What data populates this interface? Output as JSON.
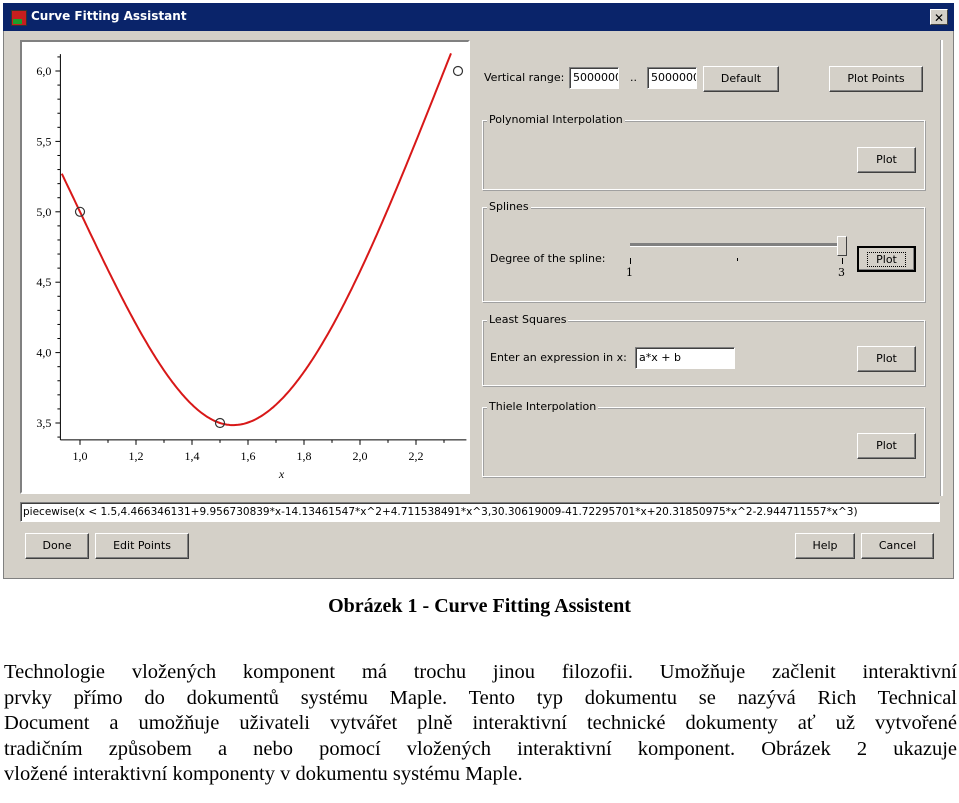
{
  "window": {
    "title": "Curve Fitting Assistant",
    "close_label": "✕"
  },
  "plot": {
    "chart_data": {
      "type": "line",
      "xlabel": "x",
      "ylabel": "",
      "x_ticks": [
        "1,0",
        "1,2",
        "1,4",
        "1,6",
        "1,8",
        "2,0",
        "2,2"
      ],
      "y_ticks": [
        "3,5",
        "4,0",
        "4,5",
        "5,0",
        "5,5",
        "6,0"
      ],
      "x_tick_values": [
        1.0,
        1.2,
        1.4,
        1.6,
        1.8,
        2.0,
        2.2
      ],
      "y_tick_values": [
        3.5,
        4.0,
        4.5,
        5.0,
        5.5,
        6.0
      ],
      "xlim": [
        0.92,
        2.38
      ],
      "ylim": [
        3.4,
        6.1
      ],
      "points": [
        {
          "x": 1.0,
          "y": 5.0
        },
        {
          "x": 1.5,
          "y": 3.5
        },
        {
          "x": 2.35,
          "y": 6.0
        }
      ],
      "series": [
        {
          "name": "spline",
          "color": "#d81818",
          "piecewise_break": 1.5,
          "left_coeffs": [
            4.466346131,
            9.956730839,
            -14.13461547,
            4.711538491
          ],
          "right_coeffs": [
            30.30619009,
            -41.72295701,
            20.31850975,
            -2.944711557
          ]
        }
      ],
      "grid": false
    }
  },
  "controls": {
    "vertical_range_label": "Vertical range:",
    "range_min": "5000000",
    "range_sep": "..",
    "range_max": "5000000",
    "default_button": "Default",
    "plot_points_button": "Plot Points",
    "polynomial": {
      "legend": "Polynomial Interpolation",
      "plot_button": "Plot"
    },
    "splines": {
      "legend": "Splines",
      "degree_label": "Degree of the spline:",
      "slider_min_label": "1",
      "slider_max_label": "3",
      "slider_value": 3,
      "plot_button": "Plot"
    },
    "least_squares": {
      "legend": "Least Squares",
      "expr_label": "Enter an expression in x:",
      "expr_value": "a*x + b",
      "plot_button": "Plot"
    },
    "thiele": {
      "legend": "Thiele Interpolation",
      "plot_button": "Plot"
    }
  },
  "result_text": "piecewise(x < 1.5,4.466346131+9.956730839*x-14.13461547*x^2+4.711538491*x^3,30.30619009-41.72295701*x+20.31850975*x^2-2.944711557*x^3)",
  "footer_buttons": {
    "done": "Done",
    "edit_points": "Edit Points",
    "help": "Help",
    "cancel": "Cancel"
  },
  "document": {
    "caption": "Obrázek 1 - Curve Fitting Assistent",
    "lines": [
      "Technologie vložených komponent má trochu jinou filozofii. Umožňuje začlenit interaktivní",
      "prvky přímo do dokumentů systému Maple. Tento typ dokumentu se nazývá Rich Technical",
      "Document a umožňuje uživateli vytvářet plně interaktivní technické dokumenty ať už vytvořené",
      "tradičním způsobem a nebo pomocí vložených interaktivní komponent. Obrázek 2 ukazuje",
      "vložené interaktivní komponenty v dokumentu systému Maple."
    ]
  }
}
